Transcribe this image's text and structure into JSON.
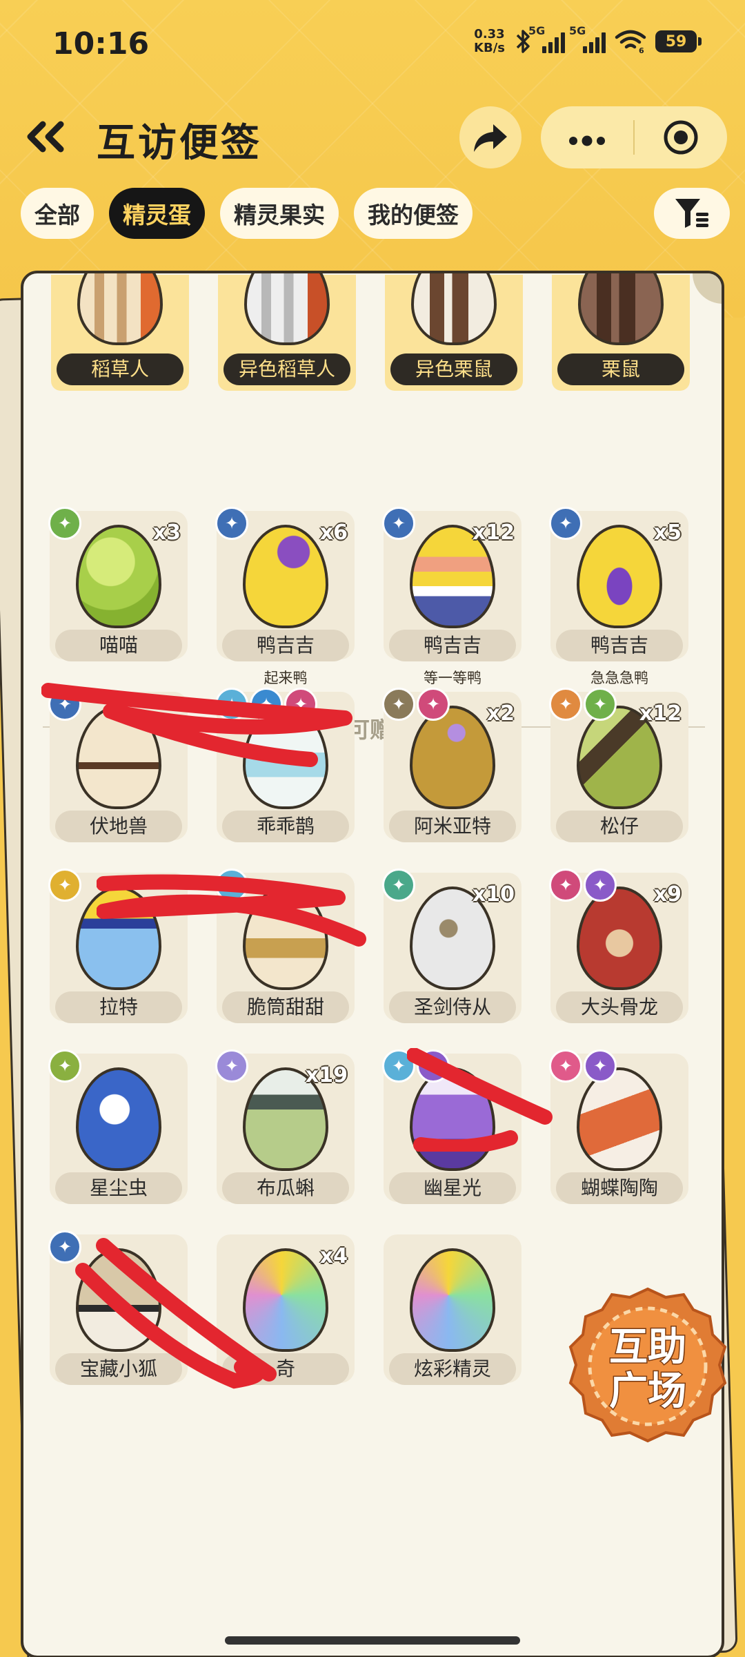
{
  "status_bar": {
    "time": "10:16",
    "net_speed_value": "0.33",
    "net_speed_unit": "KB/s",
    "sim1": "5G",
    "sim2": "5G",
    "wifi_level": "6",
    "battery": "59"
  },
  "header": {
    "title": "互访便签"
  },
  "tabs": [
    {
      "label": "全部",
      "active": false
    },
    {
      "label": "精灵蛋",
      "active": true
    },
    {
      "label": "精灵果实",
      "active": false
    },
    {
      "label": "我的便签",
      "active": false
    }
  ],
  "top_row": [
    {
      "name": "稻草人"
    },
    {
      "name": "异色稻草人"
    },
    {
      "name": "异色栗鼠"
    },
    {
      "name": "栗鼠"
    }
  ],
  "section": {
    "giftable_label": "可赠送"
  },
  "eggs": [
    {
      "name": "喵喵",
      "count": "x3",
      "subtitle": ""
    },
    {
      "name": "鸭吉吉",
      "count": "x6",
      "subtitle": "起来鸭"
    },
    {
      "name": "鸭吉吉",
      "count": "x12",
      "subtitle": "等一等鸭"
    },
    {
      "name": "鸭吉吉",
      "count": "x5",
      "subtitle": "急急急鸭"
    },
    {
      "name": "伏地兽",
      "count": "",
      "subtitle": ""
    },
    {
      "name": "乖乖鹊",
      "count": "",
      "subtitle": ""
    },
    {
      "name": "阿米亚特",
      "count": "x2",
      "subtitle": ""
    },
    {
      "name": "松仔",
      "count": "x12",
      "subtitle": ""
    },
    {
      "name": "拉特",
      "count": "",
      "subtitle": ""
    },
    {
      "name": "脆筒甜甜",
      "count": "",
      "subtitle": ""
    },
    {
      "name": "圣剑侍从",
      "count": "x10",
      "subtitle": ""
    },
    {
      "name": "大头骨龙",
      "count": "x9",
      "subtitle": ""
    },
    {
      "name": "星尘虫",
      "count": "",
      "subtitle": ""
    },
    {
      "name": "布瓜蝌",
      "count": "x19",
      "subtitle": ""
    },
    {
      "name": "幽星光",
      "count": "",
      "subtitle": ""
    },
    {
      "name": "蝴蝶陶陶",
      "count": "",
      "subtitle": ""
    },
    {
      "name": "宝藏小狐",
      "count": "",
      "subtitle": ""
    },
    {
      "name": "奇",
      "count": "x4",
      "subtitle": ""
    },
    {
      "name": "炫彩精灵",
      "count": "",
      "subtitle": ""
    }
  ],
  "help_plaza": {
    "line1": "互助",
    "line2": "广场"
  },
  "colors": {
    "background": "#f6c94f",
    "active_tab": "#161616",
    "active_tab_text": "#ffd360",
    "scribble": "#e3262f"
  }
}
